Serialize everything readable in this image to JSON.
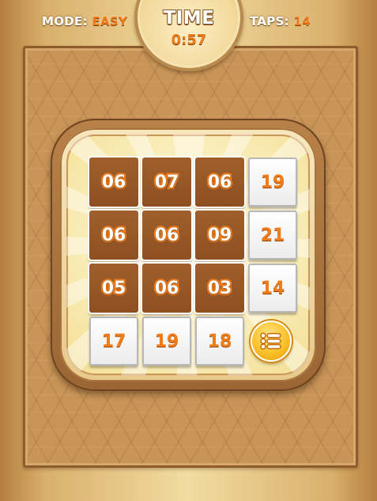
{
  "header": {
    "mode_label": "MODE:",
    "mode_value": "EASY",
    "timer_title": "TIME",
    "timer_value": "0:57",
    "taps_label": "TAPS:",
    "taps_value": "14"
  },
  "board": {
    "tiles": [
      {
        "value": "06",
        "style": "brown"
      },
      {
        "value": "07",
        "style": "brown"
      },
      {
        "value": "06",
        "style": "brown"
      },
      {
        "value": "19",
        "style": "white"
      },
      {
        "value": "06",
        "style": "brown"
      },
      {
        "value": "06",
        "style": "brown"
      },
      {
        "value": "09",
        "style": "brown"
      },
      {
        "value": "21",
        "style": "white"
      },
      {
        "value": "05",
        "style": "brown"
      },
      {
        "value": "06",
        "style": "brown"
      },
      {
        "value": "03",
        "style": "brown"
      },
      {
        "value": "14",
        "style": "white"
      },
      {
        "value": "17",
        "style": "white"
      },
      {
        "value": "19",
        "style": "white"
      },
      {
        "value": "18",
        "style": "white"
      }
    ],
    "menu_icon": "list-menu-icon"
  },
  "colors": {
    "accent_orange": "#f07d1a",
    "tile_brown": "#9a5a28",
    "tile_white": "#f4f4f4",
    "menu_gold": "#f9c12a"
  }
}
